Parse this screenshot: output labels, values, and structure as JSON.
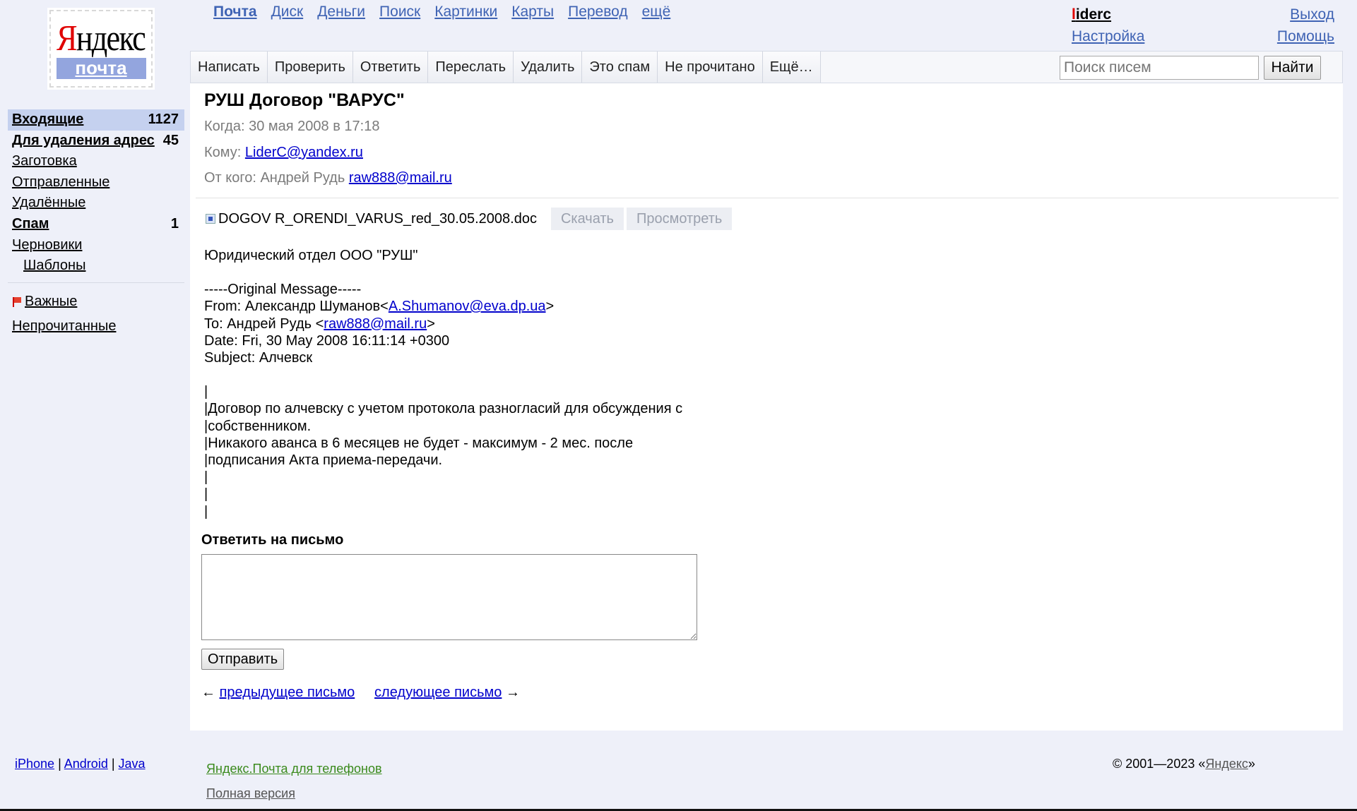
{
  "logo": {
    "brand_first": "Я",
    "brand_rest": "ндекс",
    "service": "почта"
  },
  "topnav": [
    "Почта",
    "Диск",
    "Деньги",
    "Поиск",
    "Картинки",
    "Карты",
    "Перевод",
    "ещё"
  ],
  "user": {
    "name_first": "l",
    "name_rest": "iderc",
    "settings": "Настройка"
  },
  "right_links": {
    "logout": "Выход",
    "help": "Помощь"
  },
  "toolbar": {
    "buttons": [
      "Написать",
      "Проверить",
      "Ответить",
      "Переслать",
      "Удалить",
      "Это спам",
      "Не прочитано",
      "Ещё…"
    ],
    "search_placeholder": "Поиск писем",
    "search_button": "Найти"
  },
  "sidebar": {
    "folders": [
      {
        "label": "Входящие",
        "count": "1127"
      },
      {
        "label": "Для удаления адрес",
        "count": "45"
      },
      {
        "label": "Заготовка",
        "count": ""
      },
      {
        "label": "Отправленные",
        "count": ""
      },
      {
        "label": "Удалённые",
        "count": ""
      },
      {
        "label": "Спам",
        "count": "1"
      },
      {
        "label": "Черновики",
        "count": ""
      },
      {
        "label": "Шаблоны",
        "count": ""
      }
    ],
    "important": "Важные",
    "unread": "Непрочитанные"
  },
  "message": {
    "subject": "РУШ Договор \"ВАРУС\"",
    "when_label": "Когда:",
    "when_value": "30 мая 2008 в 17:18",
    "to_label": "Кому:",
    "to_value": "LiderC@yandex.ru",
    "from_label": "От кого:",
    "from_name": "Андрей Рудь",
    "from_email": "raw888@mail.ru",
    "attachment": {
      "filename": "DOGOV R_ORENDI_VARUS_red_30.05.2008.doc",
      "download": "Скачать",
      "view": "Просмотреть"
    },
    "body": {
      "line1": "Юридический отдел ООО \"РУШ\"",
      "orig_header": "-----Original Message-----",
      "from_prefix": "From: Александр Шуманов<",
      "from_email": "A.Shumanov@eva.dp.ua",
      "from_suffix": ">",
      "to_prefix": "To: Андрей Рудь <",
      "to_email": "raw888@mail.ru",
      "to_suffix": ">",
      "date": "Date: Fri, 30 May 2008 16:11:14 +0300",
      "subject": "Subject: Алчевск",
      "q0": "|",
      "q1": "|Договор по алчевску с учетом протокола разногласий для обсуждения с",
      "q2": "|собственником.",
      "q3": "|Никакого аванса в 6 месяцев не будет - максимум - 2 мес. после",
      "q4": "|подписания Акта приема-передачи.",
      "q5": "|",
      "q6": "|",
      "q7": "|"
    }
  },
  "reply": {
    "title": "Ответить на письмо",
    "send": "Отправить"
  },
  "pager": {
    "prev_arrow": "←",
    "prev": "предыдущее письмо",
    "next": "следующее письмо",
    "next_arrow": "→"
  },
  "footer": {
    "apps": [
      "iPhone",
      "Android",
      "Java"
    ],
    "separator": "|",
    "phones": "Яндекс.Почта для телефонов",
    "full": "Полная версия",
    "copyright_prefix": "© 2001—2023 «",
    "copyright_link": "Яндекс",
    "copyright_suffix": "»"
  }
}
